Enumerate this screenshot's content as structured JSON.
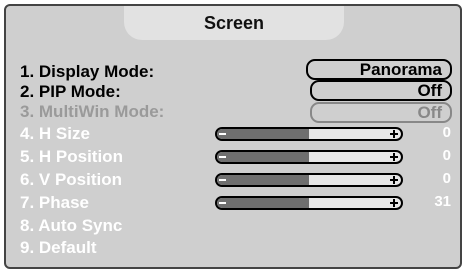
{
  "title": "Screen",
  "menu": {
    "items": [
      {
        "label": "1. Display Mode:",
        "value": "Panorama",
        "state": "active"
      },
      {
        "label": "2. PIP Mode:",
        "value": "Off",
        "state": "active"
      },
      {
        "label": "3. MultiWin Mode:",
        "value": "Off",
        "state": "dimmed"
      },
      {
        "label": "4. H Size",
        "value": "0",
        "state": "disabled",
        "level": 0.5
      },
      {
        "label": "5. H Position",
        "value": "0",
        "state": "disabled",
        "level": 0.5
      },
      {
        "label": "6. V Position",
        "value": "0",
        "state": "disabled",
        "level": 0.5
      },
      {
        "label": "7. Phase",
        "value": "31",
        "state": "disabled",
        "level": 0.5
      },
      {
        "label": "8. Auto Sync",
        "state": "disabled"
      },
      {
        "label": "9. Default",
        "state": "disabled"
      }
    ]
  }
}
